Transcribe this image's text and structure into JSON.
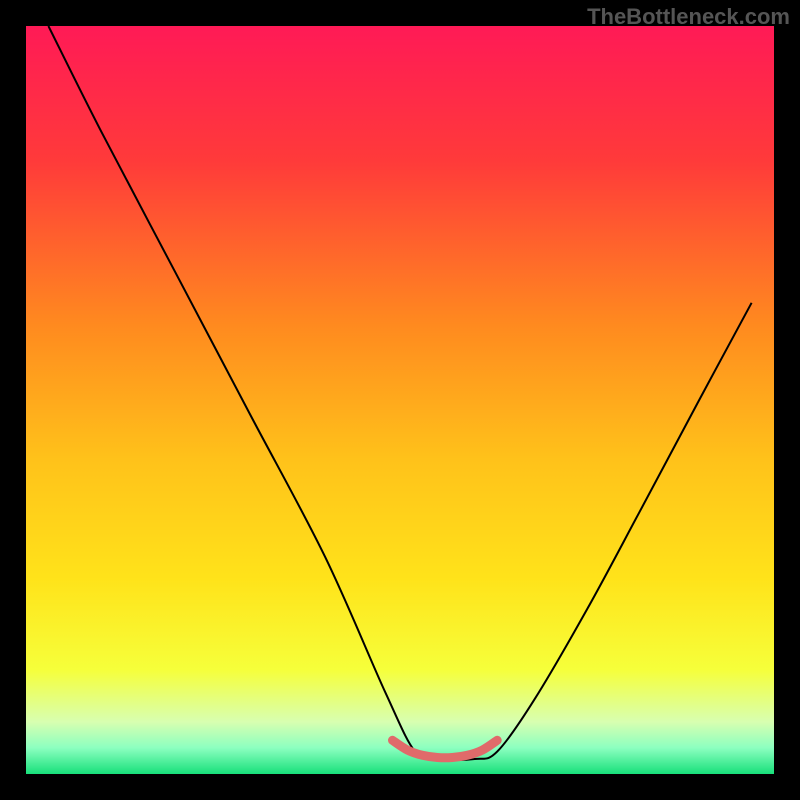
{
  "watermark": "TheBottleneck.com",
  "chart_data": {
    "type": "line",
    "title": "",
    "xlabel": "",
    "ylabel": "",
    "xlim": [
      0,
      100
    ],
    "ylim": [
      0,
      100
    ],
    "series": [
      {
        "name": "bottleneck-curve",
        "x": [
          3,
          10,
          20,
          30,
          40,
          48,
          52,
          55,
          60,
          63,
          68,
          75,
          82,
          90,
          97
        ],
        "y": [
          100,
          86,
          67,
          48,
          29,
          11,
          3,
          2,
          2,
          3,
          10,
          22,
          35,
          50,
          63
        ]
      }
    ],
    "highlight_region": {
      "name": "optimal-zone",
      "x": [
        49,
        51,
        53,
        55,
        57,
        59,
        61,
        63
      ],
      "y": [
        4.5,
        3.2,
        2.5,
        2.2,
        2.2,
        2.5,
        3.2,
        4.5
      ]
    },
    "gradient_stops": [
      {
        "offset": 0.0,
        "color": "#ff1a56"
      },
      {
        "offset": 0.18,
        "color": "#ff3a3a"
      },
      {
        "offset": 0.4,
        "color": "#ff8a1f"
      },
      {
        "offset": 0.58,
        "color": "#ffc21a"
      },
      {
        "offset": 0.74,
        "color": "#ffe31a"
      },
      {
        "offset": 0.86,
        "color": "#f6ff3a"
      },
      {
        "offset": 0.93,
        "color": "#d8ffb0"
      },
      {
        "offset": 0.965,
        "color": "#8cffc0"
      },
      {
        "offset": 1.0,
        "color": "#18e07a"
      }
    ]
  }
}
